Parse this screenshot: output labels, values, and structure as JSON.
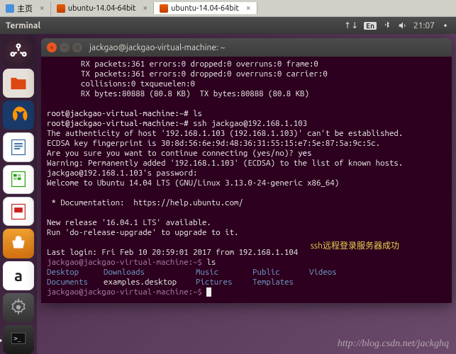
{
  "browser_tabs": [
    {
      "label": "主页",
      "kind": "home"
    },
    {
      "label": "ubuntu-14.04-64bit",
      "kind": "vm"
    },
    {
      "label": "ubuntu-14.04-64bit",
      "kind": "vm",
      "active": true
    }
  ],
  "topbar": {
    "title": "Terminal",
    "lang": "En",
    "time": "21:07"
  },
  "terminal": {
    "title": "jackgao@jackgao-virtual-machine: ~",
    "netstat": [
      "RX packets:361 errors:0 dropped:0 overruns:0 frame:0",
      "TX packets:361 errors:0 dropped:0 overruns:0 carrier:0",
      "collisions:0 txqueuelen:0",
      "RX bytes:80888 (80.8 KB)  TX bytes:80888 (80.8 KB)"
    ],
    "root_prompt": "root@jackgao-virtual-machine:~#",
    "root_cmd1": "ls",
    "root_cmd2": "ssh jackgao@192.168.1.103",
    "ssh_auth": "The authenticity of host '192.168.1.103 (192.168.1.103)' can't be established.",
    "ssh_ecdsa": "ECDSA key fingerprint is 30:8d:56:6e:9d:48:36:31:55:15:e7:5e:87:5a:9c:5c.",
    "ssh_confirm_q": "Are you sure you want to continue connecting (yes/no)?",
    "ssh_confirm_a": "yes",
    "ssh_warn": "Warning: Permanently added '192.168.1.103' (ECDSA) to the list of known hosts.",
    "ssh_pw": "jackgao@192.168.1.103's password:",
    "welcome": "Welcome to Ubuntu 14.04 LTS (GNU/Linux 3.13.0-24-generic x86_64)",
    "doc": " * Documentation:  https://help.ubuntu.com/",
    "release1": "New release '16.04.1 LTS' available.",
    "release2": "Run 'do-release-upgrade' to upgrade to it.",
    "lastlogin": "Last login: Fri Feb 10 20:59:01 2017 from 192.168.1.104",
    "user_prompt": "jackgao@jackgao-virtual-machine:~$",
    "user_cmd": "ls",
    "ls_row1": {
      "c1": "Desktop",
      "c2": "Downloads",
      "c3": "Music",
      "c4": "Public",
      "c5": "Videos"
    },
    "ls_row2": {
      "c1": "Documents",
      "c2": "examples.desktop",
      "c3": "Pictures",
      "c4": "Templates"
    }
  },
  "annotation": "ssh远程登录服务器成功",
  "watermark": "http://blog.csdn.net/jackghq"
}
